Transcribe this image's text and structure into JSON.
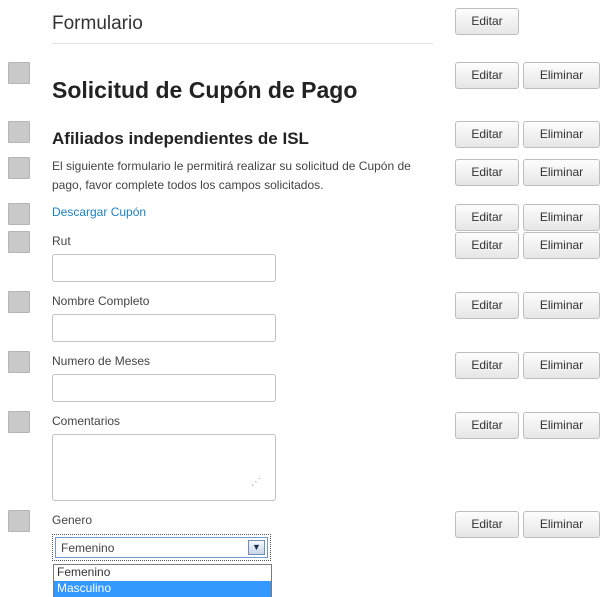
{
  "form": {
    "title": "Formulario",
    "edit_label": "Editar"
  },
  "actions": {
    "edit_label": "Editar",
    "delete_label": "Eliminar"
  },
  "fields": {
    "heading1": "Solicitud de Cupón de Pago",
    "heading2": "Afiliados independientes de ISL",
    "paragraph": "El siguiente formulario le permitirá realizar su solicitud de Cupón de pago, favor complete todos los campos solicitados.",
    "download_link": "Descargar Cupón",
    "rut": {
      "label": "Rut",
      "value": ""
    },
    "nombre": {
      "label": "Nombre Completo",
      "value": ""
    },
    "meses": {
      "label": "Numero de Meses",
      "value": ""
    },
    "comentarios": {
      "label": "Comentarios",
      "value": ""
    },
    "genero": {
      "label": "Genero",
      "selected": "Femenino",
      "options": [
        "Femenino",
        "Masculino"
      ],
      "highlighted": "Masculino"
    }
  },
  "icons": {
    "drag_handle": "drag-handle-icon",
    "select_arrow": "chevron-down-icon",
    "resize_grip": "resize-grip-icon"
  },
  "colors": {
    "link": "#1a82c4",
    "highlight": "#3399ff",
    "handle": "#c9c9c9"
  }
}
